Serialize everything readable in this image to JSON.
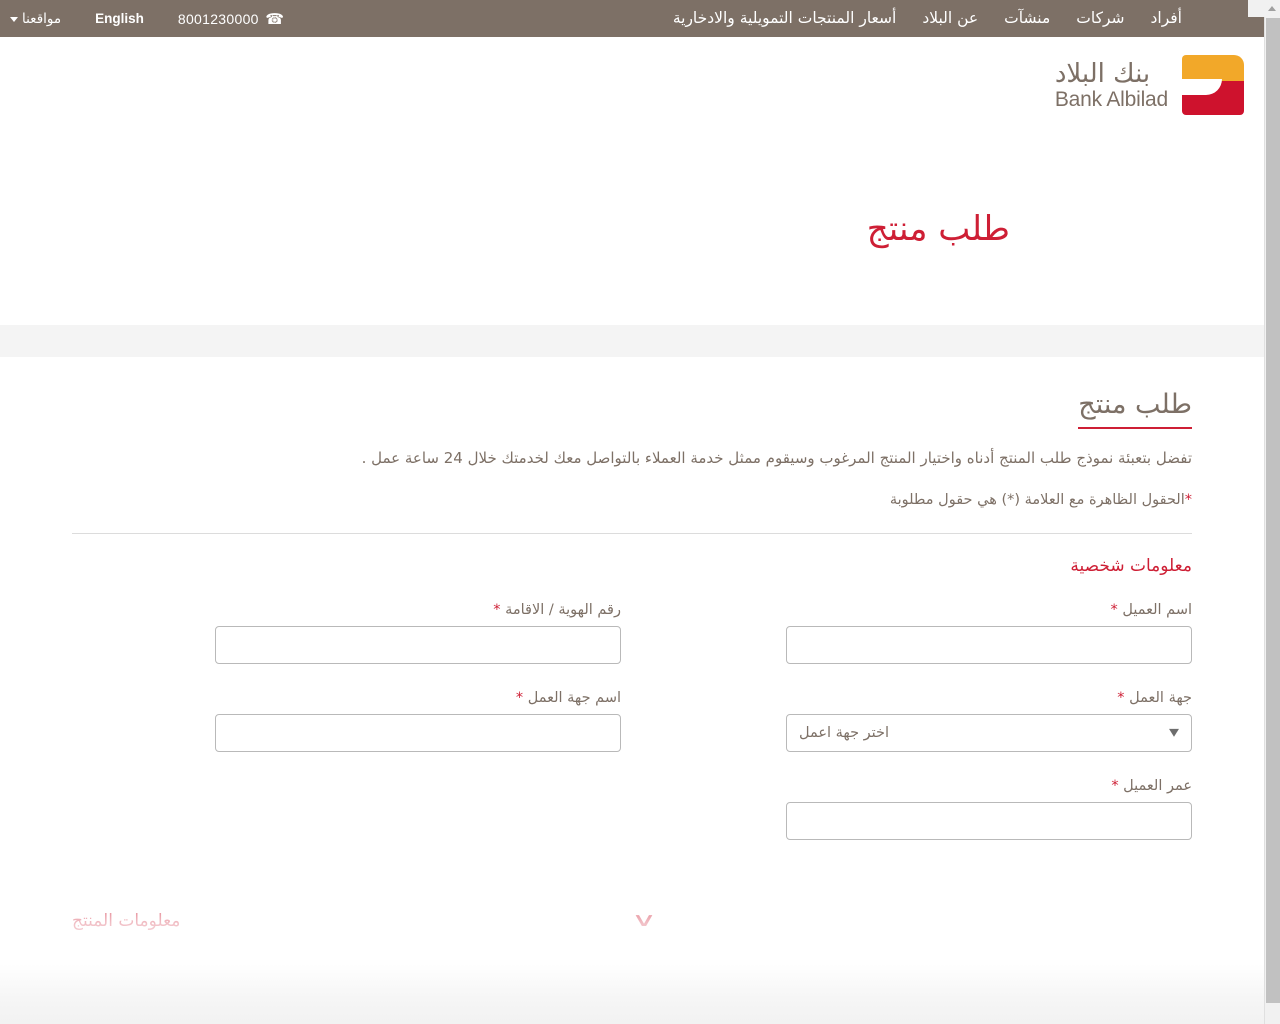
{
  "topbar": {
    "nav_items": [
      {
        "label": "أفراد",
        "name": "nav-individuals"
      },
      {
        "label": "شركات",
        "name": "nav-companies"
      },
      {
        "label": "منشآت",
        "name": "nav-enterprises"
      },
      {
        "label": "عن البلاد",
        "name": "nav-about"
      },
      {
        "label": "أسعار المنتجات التمويلية والادخارية",
        "name": "nav-rates"
      }
    ],
    "phone": "8001230000",
    "phone_icon": "phone-icon",
    "language_toggle": "English",
    "sites_label": "مواقعنا",
    "sites_caret_icon": "chevron-down-icon",
    "background": "#7d7066"
  },
  "logo": {
    "arabic": "بنك البلاد",
    "english": "Bank Albilad",
    "mark_name": "bank-albilad-logo-mark",
    "gold": "#f2a829",
    "red": "#ce122d",
    "text_color": "#7d7066"
  },
  "hero": {
    "title": "طلب منتج",
    "title_color": "#ce1f35"
  },
  "form": {
    "section_title": "طلب منتج",
    "underline_color": "#ce1f35",
    "lead": "تفضل بتعبئة نموذج طلب المنتج أدناه واختيار المنتج المرغوب وسيقوم ممثل خدمة العملاء بالتواصل معك لخدمتك خلال 24 ساعة عمل .",
    "required_note": "الحقول الظاهرة مع العلامة (*) هي حقول مطلوبة",
    "required_star": "*",
    "personal_section_title": "معلومات شخصية",
    "fields": [
      {
        "name": "customer-name",
        "label": "اسم العميل",
        "required": true,
        "type": "text",
        "value": "",
        "placeholder": ""
      },
      {
        "name": "id-number",
        "label": "رقم الهوية / الاقامة",
        "required": true,
        "type": "text",
        "value": "",
        "placeholder": ""
      },
      {
        "name": "employer",
        "label": "جهة العمل",
        "required": true,
        "type": "select",
        "value": "اختر جهة اعمل",
        "chevron_icon": "chevron-down-icon"
      },
      {
        "name": "employer-name",
        "label": "اسم جهة العمل",
        "required": true,
        "type": "text",
        "value": "",
        "placeholder": ""
      },
      {
        "name": "customer-age",
        "label": "عمر العميل",
        "required": true,
        "type": "text",
        "value": "",
        "placeholder": ""
      }
    ],
    "next_section_title": "معلومات المنتج",
    "next_section_chevron_icon": "chevron-down-icon"
  },
  "scrollbar": {
    "up_arrow_icon": "triangle-up-icon",
    "down_arrow_icon": "triangle-down-icon"
  }
}
